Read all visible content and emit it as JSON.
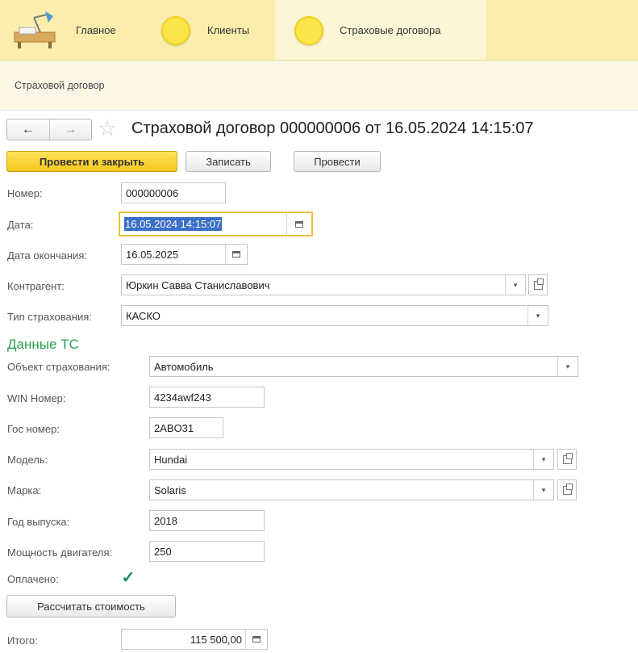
{
  "sections": {
    "main": "Главное",
    "clients": "Клиенты",
    "contracts": "Страховые договора"
  },
  "nav_panel": {
    "item": "Страховой договор"
  },
  "header": {
    "back": "←",
    "forward": "→",
    "star": "☆",
    "title": "Страховой договор 000000006 от 16.05.2024 14:15:07"
  },
  "toolbar": {
    "post_close": "Провести и закрыть",
    "save": "Записать",
    "post": "Провести"
  },
  "fields": {
    "number": {
      "label": "Номер:",
      "value": "000000006"
    },
    "date": {
      "label": "Дата:",
      "value": "16.05.2024 14:15:07"
    },
    "end_date": {
      "label": "Дата окончания:",
      "value": "16.05.2025"
    },
    "counterparty": {
      "label": "Контрагент:",
      "value": "Юркин Савва Станиславович"
    },
    "insurance_type": {
      "label": "Тип страхования:",
      "value": "КАСКО"
    }
  },
  "vehicle": {
    "section_title": "Данные ТС",
    "object": {
      "label": "Объект страхования:",
      "value": "Автомобиль"
    },
    "vin": {
      "label": "WIN Номер:",
      "value": "4234awf243"
    },
    "plate": {
      "label": "Гос номер:",
      "value": "2ABO31"
    },
    "model": {
      "label": "Модель:",
      "value": "Hundai"
    },
    "brand": {
      "label": "Марка:",
      "value": "Solaris"
    },
    "year": {
      "label": "Год выпуска:",
      "value": "2018"
    },
    "power": {
      "label": "Мощность двигателя:",
      "value": "250"
    }
  },
  "paid": {
    "label": "Оплачено:",
    "checked": true,
    "mark": "✓"
  },
  "calc_button": "Рассчитать стоимость",
  "total": {
    "label": "Итого:",
    "value": "115 500,00"
  },
  "icons": {
    "dropdown": "▾"
  }
}
